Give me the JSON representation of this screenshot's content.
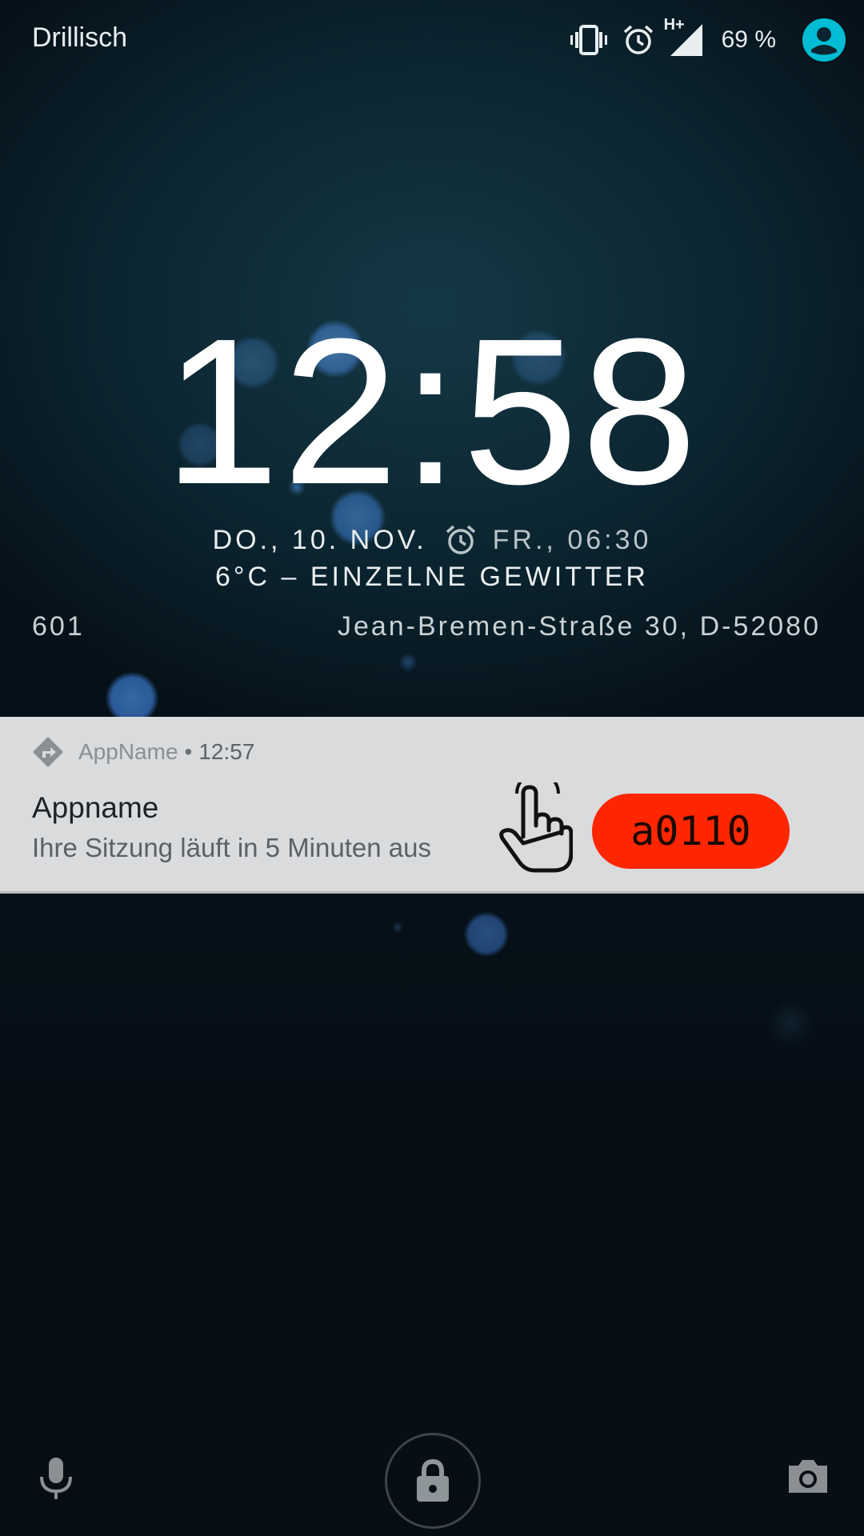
{
  "status_bar": {
    "carrier": "Drillisch",
    "network_type": "H+",
    "battery": "69 %",
    "icons": [
      "vibrate-icon",
      "alarm-icon",
      "signal-icon",
      "user-avatar-icon"
    ]
  },
  "lockscreen": {
    "time": "12:58",
    "date": "DO., 10. NOV.",
    "next_alarm": "FR., 06:30",
    "weather": "6°C – EINZELNE GEWITTER",
    "marquee_left": "601",
    "marquee_right": "Jean-Bremen-Straße 30, D-52080"
  },
  "notification": {
    "app_name": "AppName",
    "time": "12:57",
    "title": "Appname",
    "text": "Ihre Sitzung läuft in 5 Minuten aus",
    "action_label": "a0110",
    "action_color": "#ff2600",
    "icons": [
      "app-directions-icon",
      "tap-hand-icon"
    ]
  },
  "bottom_bar": {
    "icons": [
      "microphone-icon",
      "lock-icon",
      "camera-icon"
    ]
  },
  "colors": {
    "avatar": "#00bcd4",
    "notification_bg": "#d9dbdd",
    "background": "#0b2530"
  }
}
